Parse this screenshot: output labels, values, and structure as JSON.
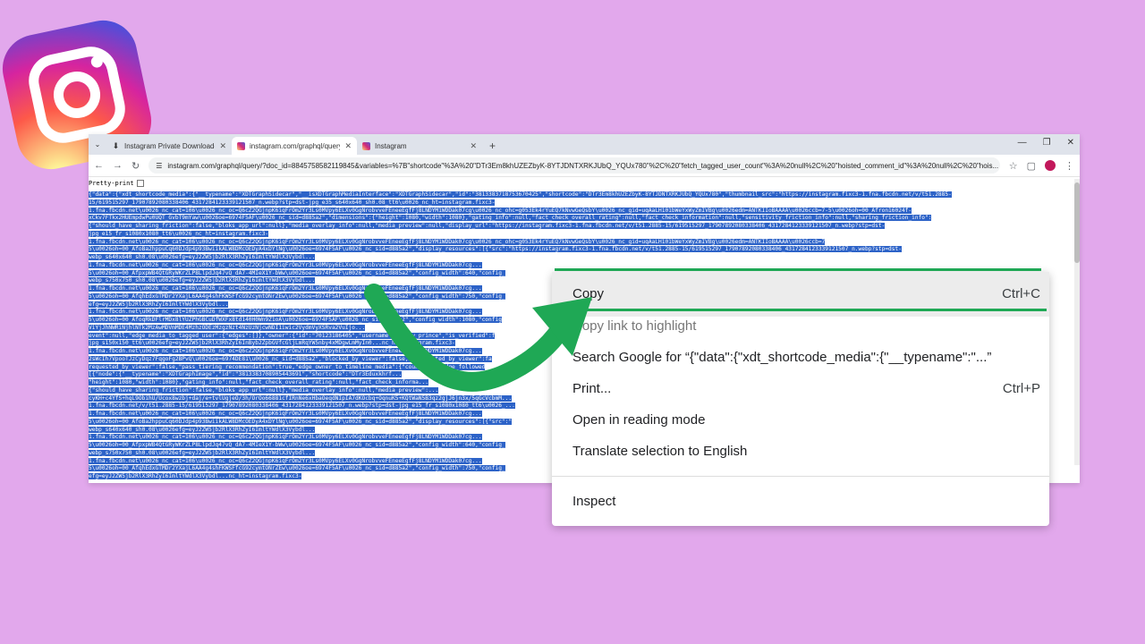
{
  "browser": {
    "tabs": [
      {
        "title": "Instagram Private Downloader",
        "icon": "download-icon"
      },
      {
        "title": "instagram.com/graphql/query/",
        "icon": "instagram-icon"
      },
      {
        "title": "Instagram",
        "icon": "instagram-icon"
      }
    ],
    "url": "instagram.com/graphql/query/?doc_id=8845758582119845&variables=%7B\"shortcode\"%3A%20\"DTr3Em8khUZEZbyK-8YTJDNTXRKJUbQ_YQUx780\"%2C%20\"fetch_tagged_user_count\"%3A%20null%2C%20\"hoisted_comment_id\"%3A%20null%2C%20\"hois..."
  },
  "page": {
    "pretty_print_label": "Pretty-print",
    "json_lines": [
      "{\"data\":{\"xdt_shortcode_media\":{\"__typename\":\"XDTGraphSidecar\",\"__isXDTGraphMediaInterface\":\"XDTGraphSidecar\",\"id\":\"3813383718753670425\",\"shortcode\":\"DTr3Em8khUZEZbyK-8YTJDNTXRKJUbQ_YQUx780\",\"thumbnail_src\":\"https://instagram.fixc3-1.fna.fbcdn.net/v/t51.2885-",
      "15/619515297_17907892080338406_4317284123339121507_n.webp?stp=dst-jpg_e35_s640x640_sh0.08_tt6\\u0026_nc_ht=instagram.fixc3-",
      "1.fna.fbcdn.net\\u0026_nc_cat=106\\u0026_nc_oc=Q6cZ2QGjnpK6iqFrOm2Yr3Ls0MVpy6ELXv0GgNrobvveFEneeEgfFj8LNDYM1WDDak07cg\\u0026_nc_ohc=g053Ek4rYuEQ7kNvwGeQsbY\\u0026_nc_gid=uqAaLH101bWeYxWyZmIVBg\\u0026edm=ANTKIIoBAAAA\\u0026ccb=7-5\\u0026oh=00_Afron16024f-",
      "xCkv7FTkx2HUEmpdwPu0UQT_GvbT9mYaw\\u0026oe=6974F5AF\\u0026_nc_sid=d885a2\",\"dimensions\":{\"height\":1080,\"width\":1080},\"gating_info\":null,\"fact_check_overall_rating\":null,\"fact_check_information\":null,\"sensitivity_friction_info\":null,\"sharing_friction_info\":",
      "{\"should_have_sharing_friction\":false,\"bloks_app_url\":null},\"media_overlay_info\":null,\"media_preview\":null,\"display_url\":\"https://instagram.fixc3-1.fna.fbcdn.net/v/t51.2885-15/619515297_17907892080338406_4317284123339121507_n.webp?stp=dst-",
      "jpg_e15_fr_s1080x1080_tt6\\u0026_nc_ht=instagram.fixc3-",
      "1.fna.fbcdn.net\\u0026_nc_cat=106\\u0026_nc_oc=Q6cZ2QGjnpK6iqFrOm2Yr3Ls0MVpy6ELXv0GgNrobvveFEneeEgfFj8LNDYM1WDDak07cg\\u0026_nc_ohc=g053Ek4rYuEQ7kNvwGeQsbY\\u0026_nc_gid=uqAaLH101bWeYxWyZmIVBg\\u0026edm=ANTKIIoBAAAA\\u0026ccb=7",
      "5\\u0026oh=00_AfoBa2hppuCq60DJdp4p93BwiikALW8DMcOEDyA4xDYlNg\\u0026oe=6974F5AF\\u0026_nc_sid=d885a2\",\"display_resources\":[{\"src\":\"https://instagram.fixc3-1.fna.fbcdn.net/v/t51.2885-15/619515297_17907892080338406_4317284123339121507_n.webp?stp=dst-",
      "webp_s640x640_sh0.08\\u0026efg=eyJ2ZW5jb2RlX3RhZyI6ImltYWdlX3Vybdl...",
      "1.fna.fbcdn.net\\u0026_nc_cat=106\\u0026_nc_oc=Q6cZ2QGjnpK6iqFrOm2Yr3Ls0MVpy6ELXv0GgNrobvveFEneeEgfFj8LNDYM1WDDak07cg...",
      "5\\u0026oh=00_AfpxpWB4QtGRyWKrZLP8LlpdJq47vQ_dA7-4MIeX1Y-bWw\\u0026oe=6974F5AF\\u0026_nc_sid=d885a2\",\"config_width\":640,\"config_",
      "webp_s750x750_sh0.08\\u0026efg=eyJ2ZW5jb2RlX3RhZyI6ImltYWdlX3Vybdl...",
      "1.fna.fbcdn.net\\u0026_nc_cat=106\\u0026_nc_oc=Q6cZ2QGjnpK6iqFrOm2Yr3Ls0MVpy6ELXv0GgNrobvveFEneeEgfFj8LNDYM1WDDak07cg...",
      "5\\u0026oh=00_AfqhEdxGTMDr2YXajL6AA4g4shFKWSFfcG92cymtONrZEw\\u0026oe=6974F5AF\\u0026_nc_sid=d885a2\",\"config_width\":750,\"config_",
      "efg=eyJ2ZW5jb2RlX3RhZyI6ImltYWdlX3Vybdl...",
      "1.fna.fbcdn.net\\u0026_nc_cat=106\\u0026_nc_oc=Q6cZ2QGjnpK6iqFrOm2Yr3Ls0MVpy6ELXv0GgNrobvveFEneeEgfFj8LNDYM1WDDak07cg...",
      "5\\u0026oh=00_AfoqRkDFlrMDx8lYUZPhGBCuDfWXFx8td140H0Wn9Z1oA\\u0026oe=6974F5AF\\u0026_nc_sid=d885a2\",\"config_width\":1080,\"config",
      "ViYjJhNWRiNjhlNTk2MzAwMDVmMDE4MzhzODEzMzgzNzt4NzUzNjcwNDI1iwic2VydmVyXSRva2VuIjo...",
      "event\":null,\"edge_media_to_tagged_user\":{\"edges\":[]},\"owner\":{\"id\":\"70123186405\",\"username\":\"glaxy_prince\",\"is_verified\":f",
      "jpg_s150x150_tt6\\u0026efg=eyJ2ZW5jb2RlX3RhZyI6InByb2ZpbGVfcGljLmRqYW5nby4xMDgwLmMyIn0...nc_ht=instagram.fixc3-",
      "1.fna.fbcdn.net\\u0026_nc_cat=106\\u0026_nc_oc=Q6cZ2QGjnpK6iqFrOm2Yr3Ls0MVpy6ELXv0GgNrobvveFEneeEgfFj8LNDYM1WDDak07cg...",
      "2sWcIh7VpooTJzCyDqz7FqgoFg2BPvQ\\u0026oe=6974DE81\\u0026_nc_sid=d885a2\",\"blocked_by_viewer\":false,\"restricted_by_viewer\":fa",
      "requested_by_viewer\":false,\"pass_tiering_recommendation\":true,\"edge_owner_to_timeline_media\":{\"count\":7},\"edge_followed",
      "[{\"node\":{\"__typename\":\"XDTGraphImage\",\"id\":\"3813383708905443691\",\"shortcode\":\"DTr3Eduxkhrf...",
      "\"height\":1080,\"width\":1080},\"gating_info\":null,\"fact_check_overall_rating\":null,\"fact_check_informa...",
      "{\"should_have_sharing_friction\":false,\"bloks_app_url\":null},\"media_overlay_info\":null,\"media_preview\":...",
      "cyKH+c4YfS+hqL9ObihU/Ucox8wzbj+daj/e+tvlUgjeO/3h/OrOo66881cfIRnNe6xHbaOeqdNIpIA7dKOcbq+OqnuK5+KQtWaN5B3qz2gjJ6jn3x/5qGcVcbmM...",
      "1.fna.fbcdn.net/v/t51.2885-15/619515297_17907892080338406_4317284123339121507_n.webp?stp=dst-jpg_e15_fr_s1080x1080_tt6\\u0026_...",
      "1.fna.fbcdn.net\\u0026_nc_cat=106\\u0026_nc_oc=Q6cZ2QGjnpK6iqFrOm2Yr3Ls0MVpy6ELXv0GgNrobvveFEneeEgfFj8LNDYM1WDDak07cg...",
      "5\\u0026oh=00_AfoBa2hppuCq60DJdp4p93BwiikALW8DMcOEDyA4xDYlNg\\u0026oe=6974F5AF\\u0026_nc_sid=d885a2\",\"display_resources\":[{\"src\":\"",
      "webp_s640x640_sh0.08\\u0026efg=eyJ2ZW5jb2RlX3RhZyI6ImltYWdlX3Vybdl...",
      "1.fna.fbcdn.net\\u0026_nc_cat=106\\u0026_nc_oc=Q6cZ2QGjnpK6iqFrOm2Yr3Ls0MVpy6ELXv0GgNrobvveFEneeEgfFj8LNDYM1WDDak07cg...",
      "5\\u0026oh=00_AfpxpWB4QtGRyWKrZLP8LlpdJq47vQ_dA7-4MIeX1Y-bWw\\u0026oe=6974F5AF\\u0026_nc_sid=d885a2\",\"config_width\":640,\"config_",
      "webp_s750x750_sh0.08\\u0026efg=eyJ2ZW5jb2RlX3RhZyI6ImltYWdlX3Vybdl...",
      "1.fna.fbcdn.net\\u0026_nc_cat=106\\u0026_nc_oc=Q6cZ2QGjnpK6iqFrOm2Yr3Ls0MVpy6ELXv0GgNrobvveFEneeEgfFj8LNDYM1WDDak07cg...",
      "5\\u0026oh=00_AfqhEdxGTMDr2YXajL6AA4g4shFKWSFfcG92cymtONrZEw\\u0026oe=6974F5AF\\u0026_nc_sid=d885a2\",\"config_width\":750,\"config_",
      "efg=eyJ2ZW5jb2RlX3RhZyI6ImltYWdlX3Vybdl...nc_ht=instagram.fixc3-"
    ]
  },
  "context_menu": {
    "items": [
      {
        "label": "Copy",
        "shortcut": "Ctrl+C"
      },
      {
        "label": "Copy link to highlight",
        "shortcut": ""
      },
      {
        "label": "Search Google for “{\"data\":{\"xdt_shortcode_media\":{\"__typename\":\"...”",
        "shortcut": ""
      },
      {
        "label": "Print...",
        "shortcut": "Ctrl+P"
      },
      {
        "label": "Open in reading mode",
        "shortcut": ""
      },
      {
        "label": "Translate selection to English",
        "shortcut": ""
      },
      {
        "label": "Inspect",
        "shortcut": ""
      }
    ]
  },
  "colors": {
    "background": "#e2a8ec",
    "selection": "#2d63c8",
    "highlight_line": "#1fa855"
  }
}
